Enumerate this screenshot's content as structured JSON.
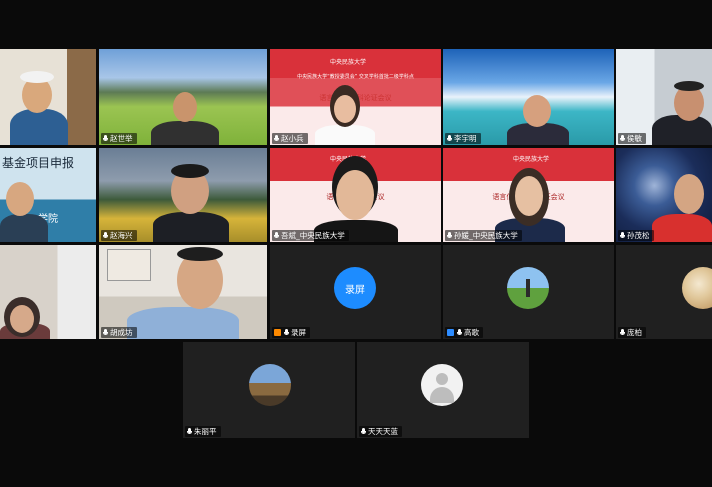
{
  "participants": [
    {
      "id": "t1",
      "name": "",
      "muted": true
    },
    {
      "id": "t2",
      "name": "赵世举"
    },
    {
      "id": "t3",
      "name": "赵小兵"
    },
    {
      "id": "t4",
      "name": "李宇明"
    },
    {
      "id": "t5",
      "name": "侯敏"
    },
    {
      "id": "t6",
      "name": ""
    },
    {
      "id": "t7",
      "name": "赵海兴"
    },
    {
      "id": "t8",
      "name": "吾斌_中央民族大学"
    },
    {
      "id": "t9",
      "name": "孙媛_中央民族大学"
    },
    {
      "id": "t10",
      "name": "孙茂松"
    },
    {
      "id": "t11",
      "name": "胡成坊"
    },
    {
      "id": "t12",
      "name": ""
    },
    {
      "id": "t13",
      "name": "录屏"
    },
    {
      "id": "t14",
      "name": "高歌"
    },
    {
      "id": "t15",
      "name": "庞柏"
    },
    {
      "id": "t16",
      "name": "朱丽平"
    },
    {
      "id": "t17",
      "name": "天天天蓝"
    }
  ],
  "slides": {
    "university": "中央民族大学",
    "s3_title": "中央民族大学“教授委员会” 交叉学科首批二级学科点",
    "s3_sub": "语言信息 学科论证会议",
    "s8_sub": "语言信息 论证会议",
    "s9_sub": "语言信息 学科论证会议",
    "s6_text": "基金项目申报",
    "s6_text2": "学院"
  },
  "record_label": "录屏",
  "colors": {
    "slide_red": "#d9313a",
    "record_blue": "#1d8cff",
    "tile_dark": "#202020"
  }
}
